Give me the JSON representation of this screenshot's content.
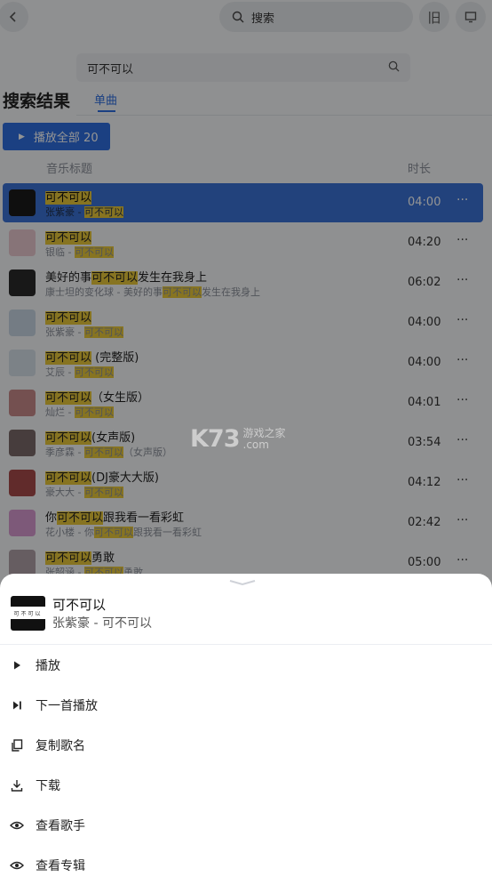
{
  "topbar": {
    "back_icon": "chevron-left-icon",
    "search_placeholder": "搜索",
    "old_button_label": "旧",
    "screen_icon": "monitor-icon"
  },
  "search": {
    "query": "可不可以"
  },
  "page": {
    "title": "搜索结果",
    "tab_label": "单曲",
    "play_all_label": "播放全部 20",
    "col_title": "音乐标题",
    "col_duration": "时长"
  },
  "songs": [
    {
      "pre": "",
      "hl": "可不可以",
      "post": "",
      "sub_pre": "张紫豪 - ",
      "sub_hl": "可不可以",
      "sub_post": "",
      "duration": "04:00",
      "selected": true
    },
    {
      "pre": "",
      "hl": "可不可以",
      "post": "",
      "sub_pre": "银临 - ",
      "sub_hl": "可不可以",
      "sub_post": "",
      "duration": "04:20"
    },
    {
      "pre": "美好的事",
      "hl": "可不可以",
      "post": "发生在我身上",
      "sub_pre": "康士坦的变化球 - 美好的事",
      "sub_hl": "可不可以",
      "sub_post": "发生在我身上",
      "duration": "06:02"
    },
    {
      "pre": "",
      "hl": "可不可以",
      "post": "",
      "sub_pre": "张紫豪 - ",
      "sub_hl": "可不可以",
      "sub_post": "",
      "duration": "04:00"
    },
    {
      "pre": "",
      "hl": "可不可以",
      "post": " (完整版)",
      "sub_pre": "艾辰 - ",
      "sub_hl": "可不可以",
      "sub_post": "",
      "duration": "04:00"
    },
    {
      "pre": "",
      "hl": "可不可以",
      "post": "（女生版）",
      "sub_pre": "灿烂 - ",
      "sub_hl": "可不可以",
      "sub_post": "",
      "duration": "04:01"
    },
    {
      "pre": "",
      "hl": "可不可以",
      "post": "(女声版)",
      "sub_pre": "季彦霖 - ",
      "sub_hl": "可不可以",
      "sub_post": "（女声版）",
      "duration": "03:54"
    },
    {
      "pre": "",
      "hl": "可不可以",
      "post": "(DJ豪大大版)",
      "sub_pre": "豪大大 - ",
      "sub_hl": "可不可以",
      "sub_post": "",
      "duration": "04:12"
    },
    {
      "pre": "你",
      "hl": "可不可以",
      "post": "跟我看一看彩虹",
      "sub_pre": "花小楼 - 你",
      "sub_hl": "可不可以",
      "sub_post": "跟我看一看彩虹",
      "duration": "02:42"
    },
    {
      "pre": "",
      "hl": "可不可以",
      "post": "勇敢",
      "sub_pre": "张韶涵 - ",
      "sub_hl": "可不可以",
      "sub_post": "勇敢",
      "duration": "05:00"
    }
  ],
  "watermark": {
    "logo": "K73",
    "line1": "游戏之家",
    "line2": ".com"
  },
  "sheet": {
    "title": "可不可以",
    "subtitle": "张紫豪 - 可不可以",
    "cover_text": "可不可以",
    "menu": [
      {
        "label": "播放",
        "icon": "play-icon"
      },
      {
        "label": "下一首播放",
        "icon": "play-next-icon"
      },
      {
        "label": "复制歌名",
        "icon": "copy-icon"
      },
      {
        "label": "下载",
        "icon": "download-icon"
      },
      {
        "label": "查看歌手",
        "icon": "eye-icon"
      },
      {
        "label": "查看专辑",
        "icon": "eye-icon"
      }
    ]
  },
  "colors": {
    "accent": "#2f6fe0",
    "selected_row": "#3b73d6",
    "highlight": "#e8c83a"
  }
}
